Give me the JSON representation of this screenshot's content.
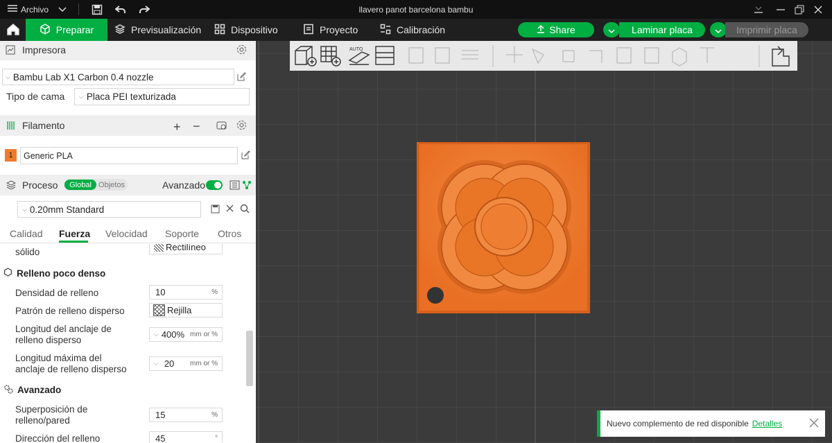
{
  "titlebar": {
    "menu_label": "Archivo",
    "window_title": "llavero panot barcelona bambu"
  },
  "nav": {
    "prepare": "Preparar",
    "preview": "Previsualización",
    "device": "Dispositivo",
    "project": "Proyecto",
    "calibration": "Calibración",
    "share": "Share",
    "slice": "Laminar placa",
    "print": "Imprimir placa"
  },
  "printer": {
    "section": "Impresora",
    "name": "Bambu Lab X1 Carbon 0.4 nozzle",
    "bed_label": "Tipo de cama",
    "bed_value": "Placa PEI texturizada"
  },
  "filament": {
    "section": "Filamento",
    "slot": "1",
    "name": "Generic PLA",
    "slot_color": "#f07b2d"
  },
  "process": {
    "section": "Proceso",
    "global": "Global",
    "objects": "Objetos",
    "advanced_label": "Avanzado",
    "preset": "0.20mm Standard"
  },
  "tabs": [
    "Calidad",
    "Fuerza",
    "Velocidad",
    "Soporte",
    "Otros"
  ],
  "settings": {
    "partial_label": "sólido",
    "partial_value": "Rectilíneo",
    "sparse_section": "Relleno poco denso",
    "density_label": "Densidad de relleno",
    "density_value": "10",
    "density_unit": "%",
    "pattern_label": "Patrón de relleno disperso",
    "pattern_value": "Rejilla",
    "anchor_label_1": "Longitud del anclaje de",
    "anchor_label_2": "relleno disperso",
    "anchor_value": "400%",
    "anchor_unit": "mm or %",
    "maxanchor_label_1": "Longitud máxima del",
    "maxanchor_label_2": "anclaje de relleno disperso",
    "maxanchor_value": "20",
    "maxanchor_unit": "mm or %",
    "advanced_section": "Avanzado",
    "overlap_label_1": "Superposición de",
    "overlap_label_2": "relleno/pared",
    "overlap_value": "15",
    "overlap_unit": "%",
    "direction_label": "Dirección del relleno",
    "direction_value": "45",
    "direction_unit": "°"
  },
  "toast": {
    "message": "Nuevo complemento de red disponible",
    "link": "Detalles"
  },
  "colors": {
    "accent": "#00ae42",
    "model": "#f07b2d",
    "grid_bg": "#3b3b3b"
  }
}
